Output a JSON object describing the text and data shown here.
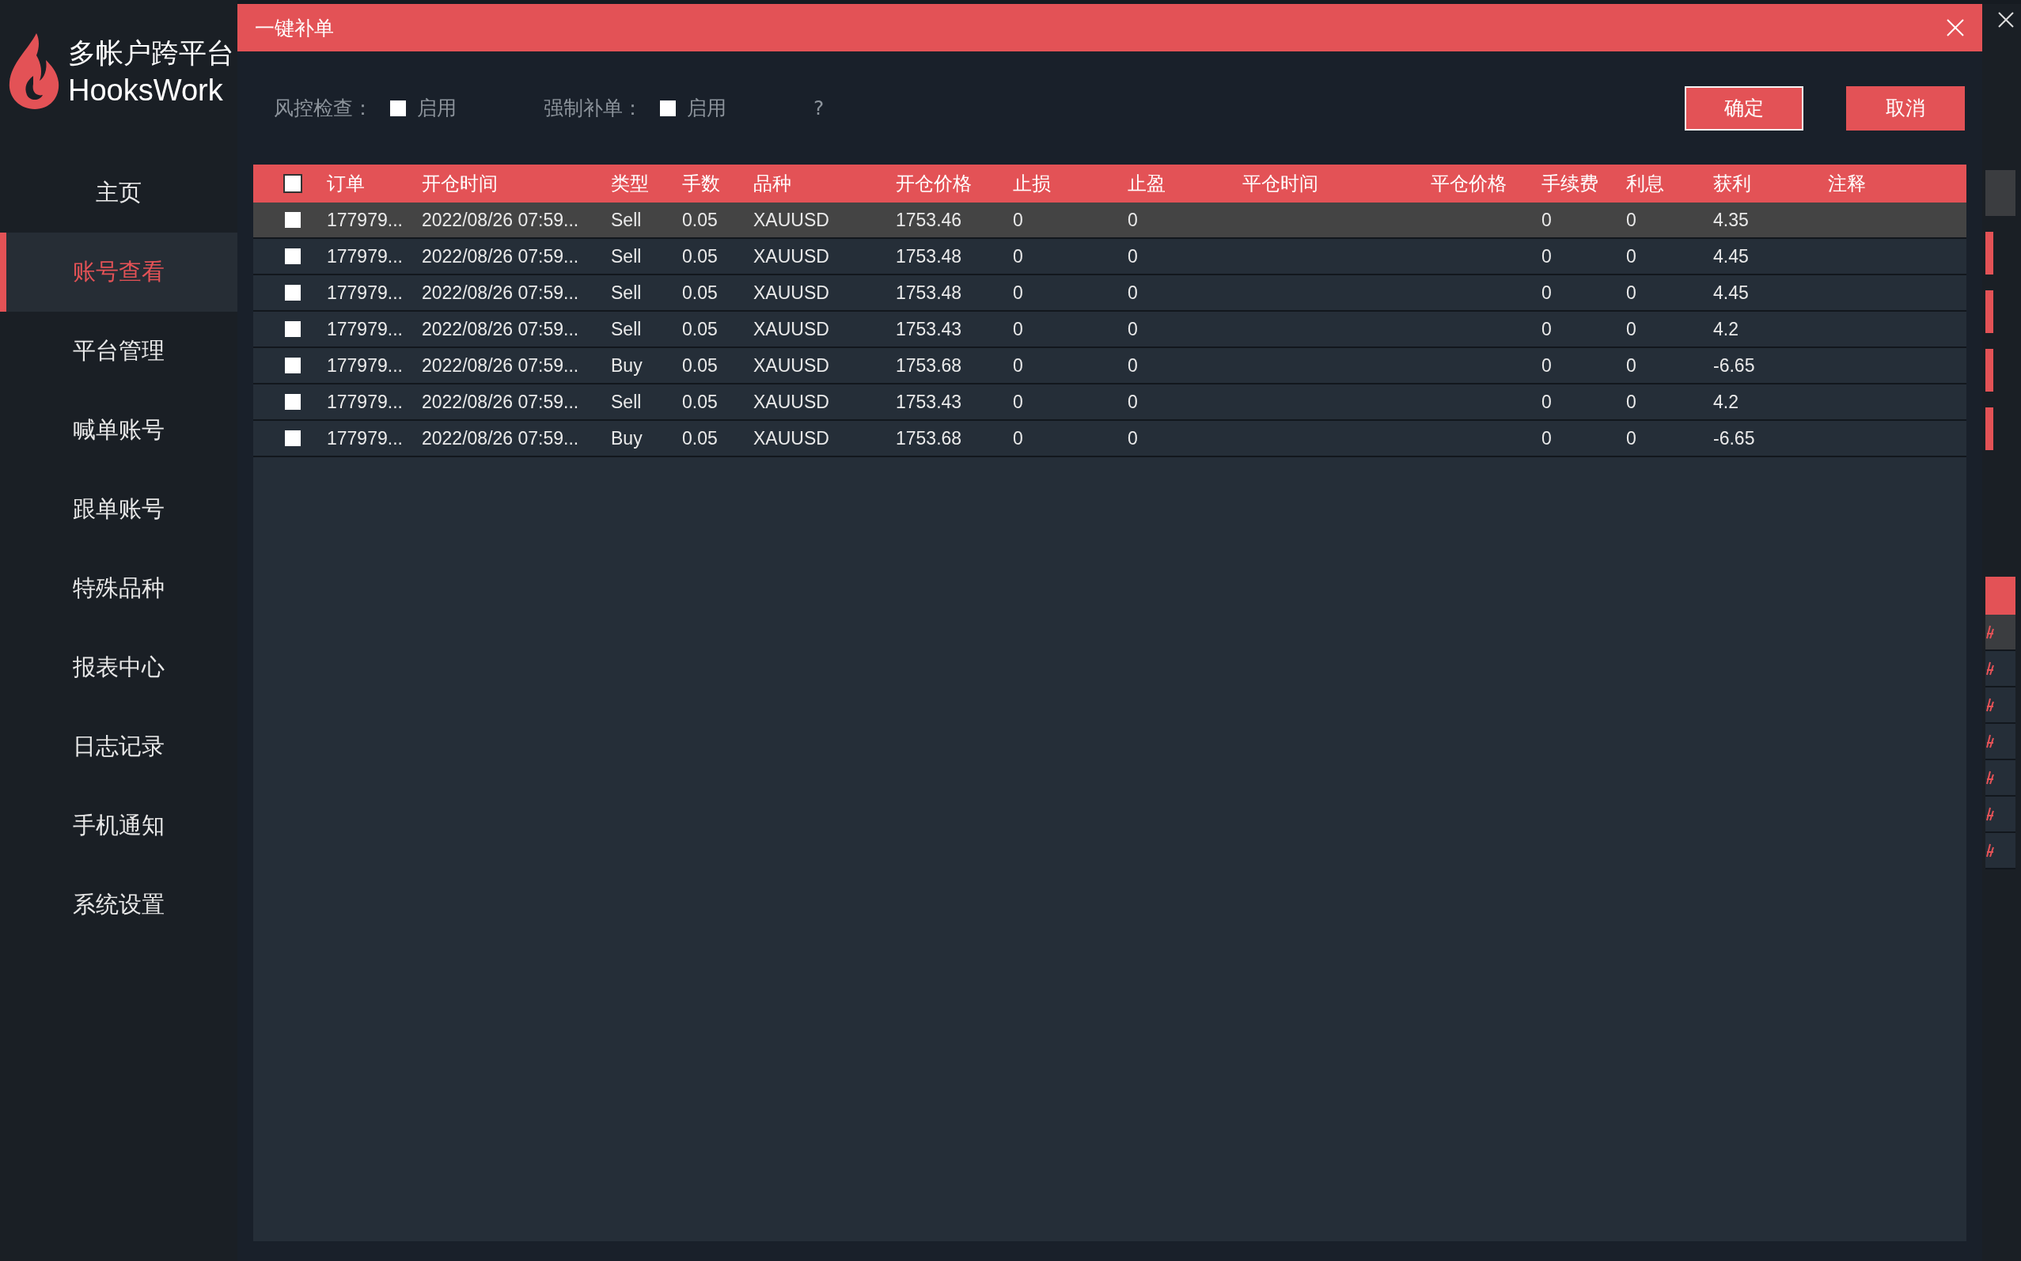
{
  "app": {
    "logo_title": "多帐户跨平台",
    "logo_subtitle": "HooksWork"
  },
  "sidebar": {
    "items": [
      {
        "label": "主页",
        "selected": false
      },
      {
        "label": "账号查看",
        "selected": true
      },
      {
        "label": "平台管理",
        "selected": false
      },
      {
        "label": "喊单账号",
        "selected": false
      },
      {
        "label": "跟单账号",
        "selected": false
      },
      {
        "label": "特殊品种",
        "selected": false
      },
      {
        "label": "报表中心",
        "selected": false
      },
      {
        "label": "日志记录",
        "selected": false
      },
      {
        "label": "手机通知",
        "selected": false
      },
      {
        "label": "系统设置",
        "selected": false
      }
    ]
  },
  "dialog": {
    "title": "一键补单",
    "options": [
      {
        "label": "风控检查：",
        "checkbox_label": "启用",
        "checked": false
      },
      {
        "label": "强制补单：",
        "checkbox_label": "启用",
        "checked": false
      }
    ],
    "help": "?",
    "buttons": [
      {
        "label": "确定",
        "focused": true
      },
      {
        "label": "取消",
        "focused": false
      }
    ],
    "table": {
      "select_all_checked": false,
      "columns": [
        "订单",
        "开仓时间",
        "类型",
        "手数",
        "品种",
        "开仓价格",
        "止损",
        "止盈",
        "平仓时间",
        "平仓价格",
        "手续费",
        "利息",
        "获利",
        "注释"
      ],
      "rows": [
        {
          "checked": false,
          "selected": true,
          "order": "177979...",
          "open_time": "2022/08/26 07:59...",
          "type": "Sell",
          "lots": "0.05",
          "symbol": "XAUUSD",
          "open_price": "1753.46",
          "stop_loss": "0",
          "take_profit": "0",
          "fee": "0",
          "interest": "0",
          "profit": "4.35"
        },
        {
          "checked": false,
          "selected": false,
          "order": "177979...",
          "open_time": "2022/08/26 07:59...",
          "type": "Sell",
          "lots": "0.05",
          "symbol": "XAUUSD",
          "open_price": "1753.48",
          "stop_loss": "0",
          "take_profit": "0",
          "fee": "0",
          "interest": "0",
          "profit": "4.45"
        },
        {
          "checked": false,
          "selected": false,
          "order": "177979...",
          "open_time": "2022/08/26 07:59...",
          "type": "Sell",
          "lots": "0.05",
          "symbol": "XAUUSD",
          "open_price": "1753.48",
          "stop_loss": "0",
          "take_profit": "0",
          "fee": "0",
          "interest": "0",
          "profit": "4.45"
        },
        {
          "checked": false,
          "selected": false,
          "order": "177979...",
          "open_time": "2022/08/26 07:59...",
          "type": "Sell",
          "lots": "0.05",
          "symbol": "XAUUSD",
          "open_price": "1753.43",
          "stop_loss": "0",
          "take_profit": "0",
          "fee": "0",
          "interest": "0",
          "profit": "4.2"
        },
        {
          "checked": false,
          "selected": false,
          "order": "177979...",
          "open_time": "2022/08/26 07:59...",
          "type": "Buy",
          "lots": "0.05",
          "symbol": "XAUUSD",
          "open_price": "1753.68",
          "stop_loss": "0",
          "take_profit": "0",
          "fee": "0",
          "interest": "0",
          "profit": "-6.65"
        },
        {
          "checked": false,
          "selected": false,
          "order": "177979...",
          "open_time": "2022/08/26 07:59...",
          "type": "Sell",
          "lots": "0.05",
          "symbol": "XAUUSD",
          "open_price": "1753.43",
          "stop_loss": "0",
          "take_profit": "0",
          "fee": "0",
          "interest": "0",
          "profit": "4.2"
        },
        {
          "checked": false,
          "selected": false,
          "order": "177979...",
          "open_time": "2022/08/26 07:59...",
          "type": "Buy",
          "lots": "0.05",
          "symbol": "XAUUSD",
          "open_price": "1753.68",
          "stop_loss": "0",
          "take_profit": "0",
          "fee": "0",
          "interest": "0",
          "profit": "-6.65"
        }
      ]
    }
  }
}
